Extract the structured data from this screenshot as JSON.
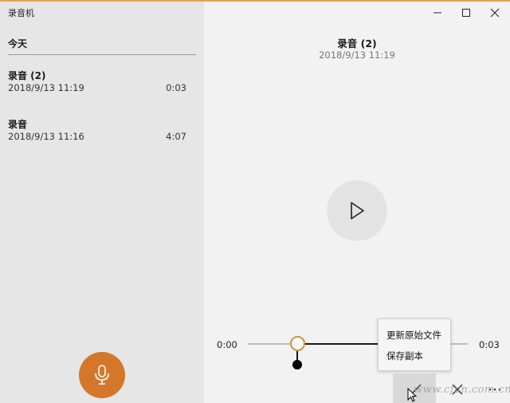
{
  "app": {
    "title": "录音机"
  },
  "sidebar": {
    "group_header": "今天",
    "recordings": [
      {
        "name": "录音 (2)",
        "date": "2018/9/13 11:19",
        "duration": "0:03"
      },
      {
        "name": "录音",
        "date": "2018/9/13 11:16",
        "duration": "4:07"
      }
    ],
    "record_icon": "microphone-icon"
  },
  "detail": {
    "title": "录音 (2)",
    "date": "2018/9/13 11:19",
    "play_icon": "play-icon"
  },
  "timeline": {
    "start": "0:00",
    "end": "0:03"
  },
  "context_menu": {
    "items": [
      "更新原始文件",
      "保存副本"
    ]
  },
  "watermark": "www.cfan.com.cn",
  "colors": {
    "accent": "#d4772a",
    "handle": "#c9943d",
    "sidebar_bg": "#e6e6e6",
    "main_bg": "#f2f2f2"
  }
}
